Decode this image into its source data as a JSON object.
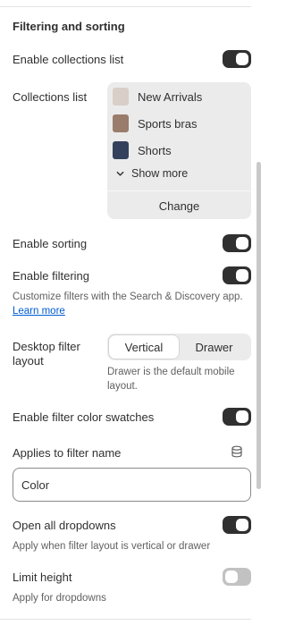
{
  "section": {
    "heading": "Filtering and sorting"
  },
  "settings": {
    "enable_collections_list": {
      "label": "Enable collections list",
      "on": true
    },
    "collections_list": {
      "label": "Collections list",
      "items": [
        {
          "name": "New Arrivals",
          "thumb_color": "#d9cfc8"
        },
        {
          "name": "Sports bras",
          "thumb_color": "#9a7c6c"
        },
        {
          "name": "Shorts",
          "thumb_color": "#33415c"
        }
      ],
      "show_more": "Show more",
      "change": "Change"
    },
    "enable_sorting": {
      "label": "Enable sorting",
      "on": true
    },
    "enable_filtering": {
      "label": "Enable filtering",
      "on": true,
      "help": "Customize filters with the Search & Discovery app.",
      "help_link": "Learn more"
    },
    "desktop_filter_layout": {
      "label": "Desktop filter layout",
      "options": [
        "Vertical",
        "Drawer"
      ],
      "selected": "Vertical",
      "help": "Drawer is the default mobile layout."
    },
    "enable_filter_color_swatches": {
      "label": "Enable filter color swatches",
      "on": true
    },
    "applies_to_filter_name": {
      "label": "Applies to filter name",
      "value": "Color",
      "icon": "database-icon"
    },
    "open_all_dropdowns": {
      "label": "Open all dropdowns",
      "on": true,
      "help": "Apply when filter layout is vertical or drawer"
    },
    "limit_height": {
      "label": "Limit height",
      "on": false,
      "help": "Apply for dropdowns"
    }
  },
  "colors": {
    "toggle_on": "#303030",
    "toggle_off": "#c2c2c2",
    "link": "#005bd3",
    "muted_text": "#616161"
  }
}
